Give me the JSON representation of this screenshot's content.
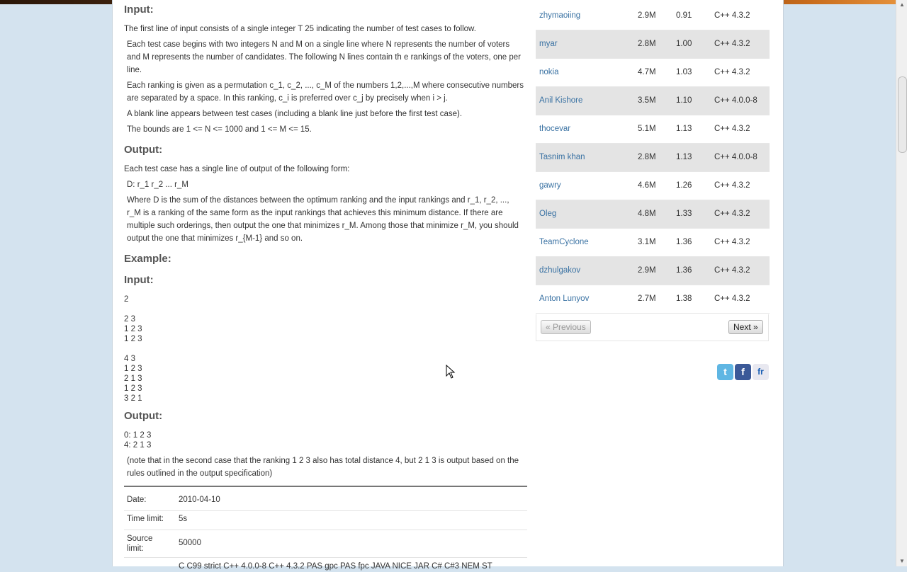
{
  "problem": {
    "input_heading": "Input:",
    "input_p1": "The first line of input consists of a single integer T 25 indicating the number of test cases to follow.",
    "input_p2": "Each test case begins with two integers N and M on a single line where N represents the number of voters and M represents the number of candidates. The following N lines contain th e rankings of the voters, one per line.",
    "input_p3": "Each ranking is given as a permutation c_1, c_2, ..., c_M of the numbers 1,2,...,M where consecutive numbers are separated by a space. In this ranking, c_i is preferred over c_j by precisely when i > j.",
    "input_p4": "A blank line appears between test cases (including a blank line just before the first test case).",
    "input_p5": "The bounds are 1 <= N <= 1000 and 1 <= M <= 15.",
    "output_heading": "Output:",
    "output_p1": "Each test case has a single line of output of the following form:",
    "output_p2": "D: r_1 r_2 ... r_M",
    "output_p3": "Where D is the sum of the distances between the optimum ranking and the input rankings and r_1, r_2, ..., r_M is a ranking of the same form as the input rankings that achieves this minimum distance. If there are multiple such orderings, then output the one that minimizes r_M. Among those that minimize r_M, you should output the one that minimizes r_{M-1} and so on.",
    "example_heading": "Example:",
    "ex_input_heading": "Input:",
    "ex_input": "2\n\n2 3\n1 2 3\n1 2 3\n\n4 3\n1 2 3\n2 1 3\n1 2 3\n3 2 1",
    "ex_output_heading": "Output:",
    "ex_output": "0: 1 2 3\n4: 2 1 3",
    "note": "(note that in the second case that the ranking 1 2 3 also has total distance 4, but 2 1 3 is output based on the rules outlined in the output specification)"
  },
  "meta": [
    {
      "key": "Date:",
      "value": "2010-04-10"
    },
    {
      "key": "Time limit:",
      "value": "5s"
    },
    {
      "key": "Source limit:",
      "value": "50000"
    },
    {
      "key": "",
      "value": "C C99 strict C++ 4.0.0-8 C++ 4.3.2 PAS gpc PAS fpc JAVA NICE JAR C# C#3 NEM ST"
    }
  ],
  "ranking": [
    {
      "user": "zhymaoiing",
      "mem": "2.9M",
      "time": "0.91",
      "lang": "C++ 4.3.2"
    },
    {
      "user": "myar",
      "mem": "2.8M",
      "time": "1.00",
      "lang": "C++ 4.3.2"
    },
    {
      "user": "nokia",
      "mem": "4.7M",
      "time": "1.03",
      "lang": "C++ 4.3.2"
    },
    {
      "user": "Anil Kishore",
      "mem": "3.5M",
      "time": "1.10",
      "lang": "C++ 4.0.0-8"
    },
    {
      "user": "thocevar",
      "mem": "5.1M",
      "time": "1.13",
      "lang": "C++ 4.3.2"
    },
    {
      "user": "Tasnim khan",
      "mem": "2.8M",
      "time": "1.13",
      "lang": "C++ 4.0.0-8"
    },
    {
      "user": "gawry",
      "mem": "4.6M",
      "time": "1.26",
      "lang": "C++ 4.3.2"
    },
    {
      "user": "Oleg",
      "mem": "4.8M",
      "time": "1.33",
      "lang": "C++ 4.3.2"
    },
    {
      "user": "TeamCyclone",
      "mem": "3.1M",
      "time": "1.36",
      "lang": "C++ 4.3.2"
    },
    {
      "user": "dzhulgakov",
      "mem": "2.9M",
      "time": "1.36",
      "lang": "C++ 4.3.2"
    },
    {
      "user": "Anton Lunyov",
      "mem": "2.7M",
      "time": "1.38",
      "lang": "C++ 4.3.2"
    }
  ],
  "pager": {
    "prev": "« Previous",
    "next": "Next »"
  },
  "social": {
    "twitter": "t",
    "facebook": "f",
    "flickr": "fr"
  }
}
